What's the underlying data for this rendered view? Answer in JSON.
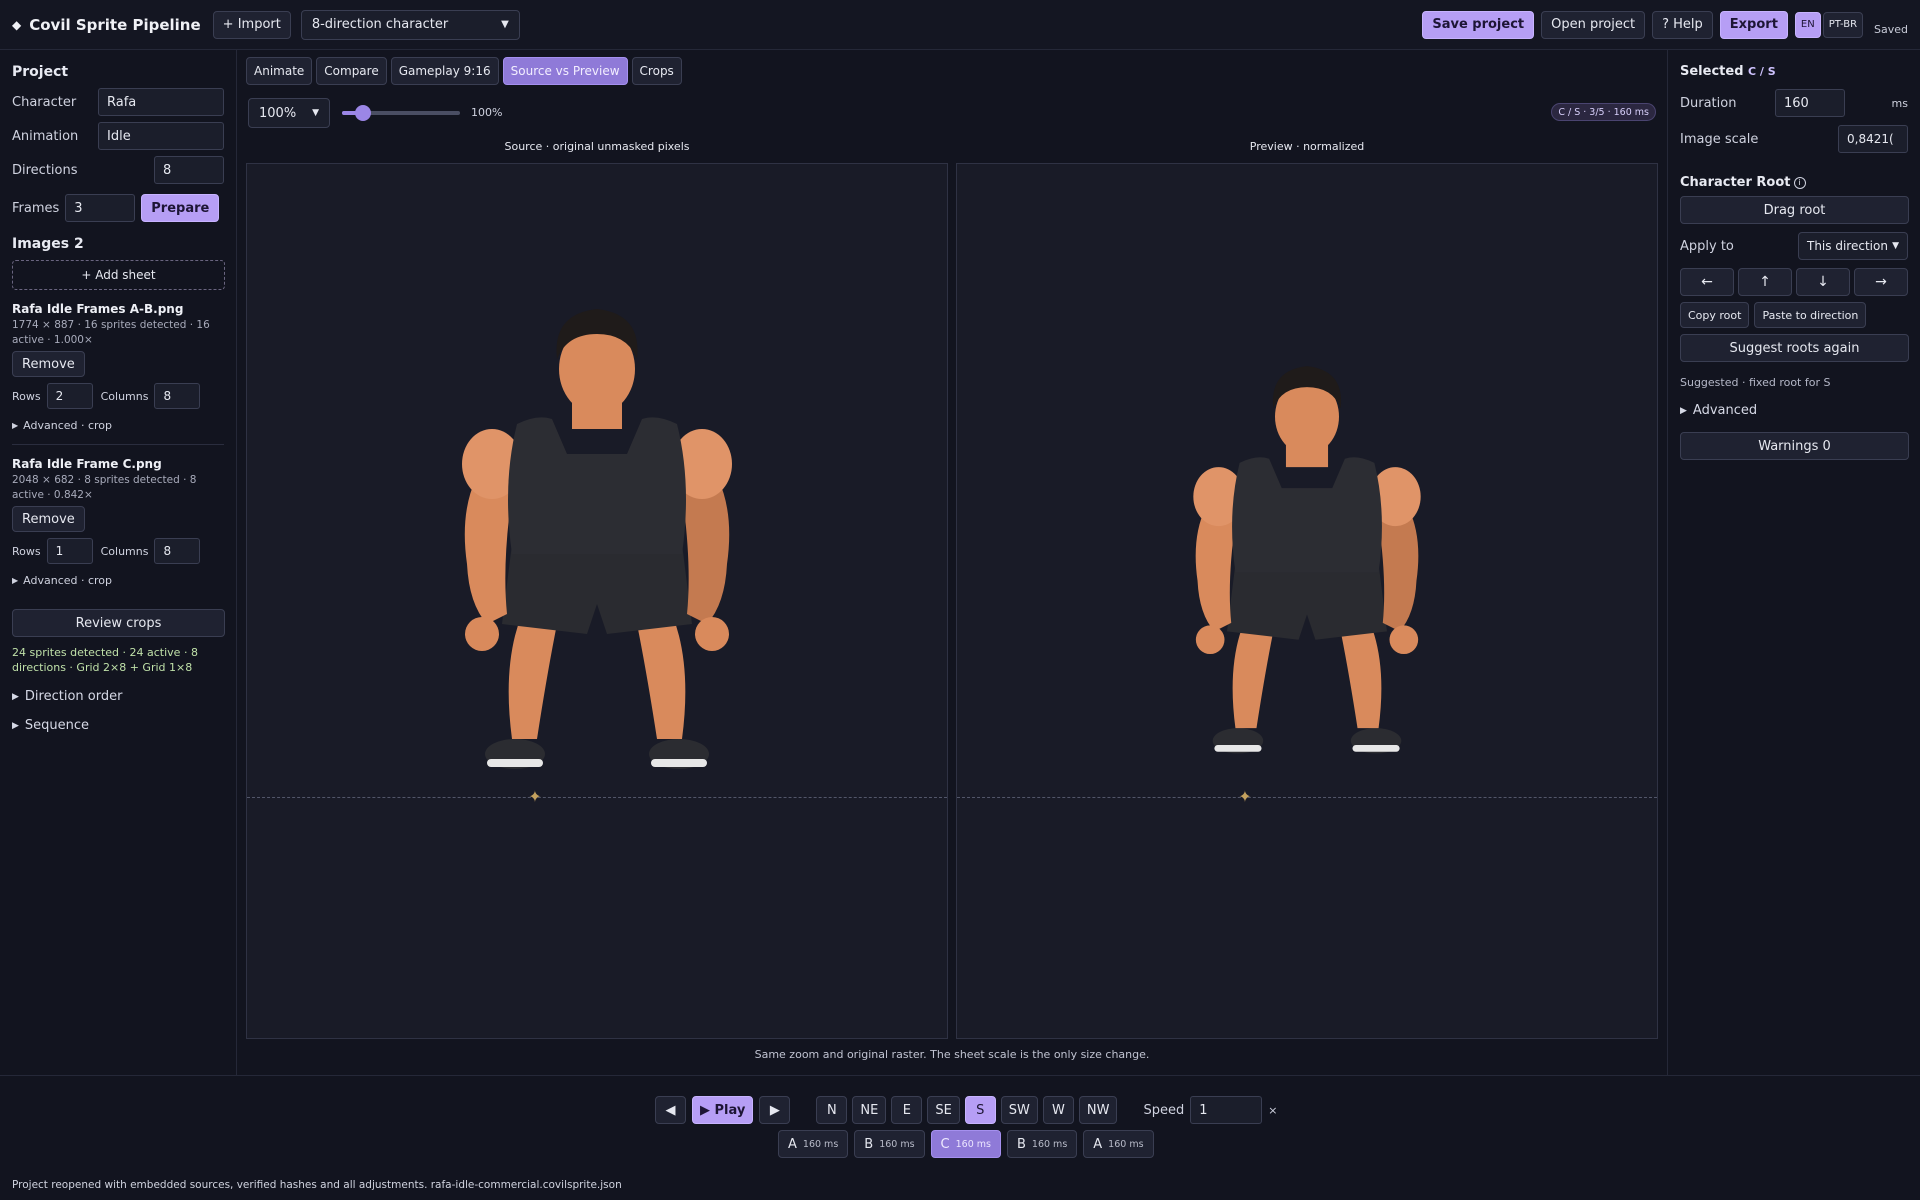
{
  "app": {
    "title": "Covil Sprite Pipeline",
    "import_label": "+ Import",
    "mode_select": "8-direction character"
  },
  "topbar": {
    "save_project": "Save project",
    "open_project": "Open project",
    "help": "? Help",
    "export": "Export",
    "lang_en": "EN",
    "lang_ptbr": "PT-BR",
    "saved": "Saved"
  },
  "project": {
    "title": "Project",
    "character_label": "Character",
    "character_value": "Rafa",
    "animation_label": "Animation",
    "animation_value": "Idle",
    "directions_label": "Directions",
    "directions_value": "8",
    "frames_label": "Frames",
    "frames_value": "3",
    "prepare": "Prepare"
  },
  "images": {
    "title": "Images 2",
    "add_sheet": "+ Add sheet",
    "sheets": [
      {
        "name": "Rafa Idle Frames A-B.png",
        "meta": "1774 × 887 · 16 sprites detected · 16 active · 1.000×",
        "remove": "Remove",
        "rows_label": "Rows",
        "rows": "2",
        "cols_label": "Columns",
        "cols": "8",
        "advanced": "Advanced · crop"
      },
      {
        "name": "Rafa Idle Frame C.png",
        "meta": "2048 × 682 · 8 sprites detected · 8 active · 0.842×",
        "remove": "Remove",
        "rows_label": "Rows",
        "rows": "1",
        "cols_label": "Columns",
        "cols": "8",
        "advanced": "Advanced · crop"
      }
    ],
    "review_crops": "Review crops",
    "summary": "24 sprites detected · 24 active · 8 directions · Grid 2×8 + Grid 1×8",
    "direction_order": "Direction order",
    "sequence": "Sequence"
  },
  "center": {
    "tabs": [
      "Animate",
      "Compare",
      "Gameplay 9:16",
      "Source vs Preview",
      "Crops"
    ],
    "active_tab": 3,
    "zoom_select": "100%",
    "zoom_level": 1.0,
    "zoom_value": "100%",
    "frame_badge": "C / S · 3/5 · 160 ms",
    "source_title": "Source · original unmasked pixels",
    "preview_title": "Preview · normalized",
    "caption": "Same zoom and original raster. The sheet scale is the only size change."
  },
  "selected": {
    "title": "Selected",
    "code": "C / S",
    "duration_label": "Duration",
    "duration_value": "160",
    "duration_unit": "ms",
    "scale_label": "Image scale",
    "scale_value": "0,8421("
  },
  "root": {
    "title": "Character Root",
    "drag_root": "Drag root",
    "apply_label": "Apply to",
    "apply_value": "This direction",
    "arrows": [
      "←",
      "↑",
      "↓",
      "→"
    ],
    "copy_root": "Copy root",
    "paste_root": "Paste to direction",
    "suggest": "Suggest roots again",
    "suggested_note": "Suggested · fixed root for S",
    "advanced": "Advanced",
    "warnings": "Warnings 0"
  },
  "playback": {
    "prev": "◀",
    "play": "▶ Play",
    "next": "▶",
    "directions": [
      "N",
      "NE",
      "E",
      "SE",
      "S",
      "SW",
      "W",
      "NW"
    ],
    "active_direction": 4,
    "speed_label": "Speed",
    "speed_value": "1",
    "speed_unit": "×",
    "frames": [
      {
        "letter": "A",
        "ms": "160 ms"
      },
      {
        "letter": "B",
        "ms": "160 ms"
      },
      {
        "letter": "C",
        "ms": "160 ms"
      },
      {
        "letter": "B",
        "ms": "160 ms"
      },
      {
        "letter": "A",
        "ms": "160 ms"
      }
    ],
    "active_frame": 2
  },
  "status": "Project reopened with embedded sources, verified hashes and all adjustments. rafa-idle-commercial.covilsprite.json",
  "colors": {
    "accent": "#b69ef5",
    "accent_dark": "#8f7ad8",
    "bg": "#12141f",
    "root_marker": "#c4a15e"
  }
}
